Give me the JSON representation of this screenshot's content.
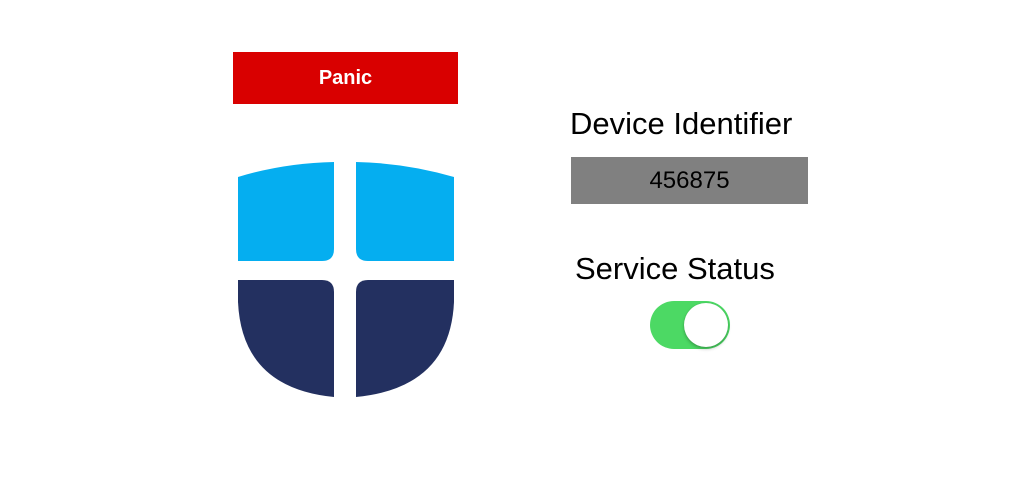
{
  "panic": {
    "label": "Panic",
    "color": "#d90000"
  },
  "logo": {
    "icon": "shield-icon",
    "colors": {
      "top": "#05aef0",
      "bottom": "#233060"
    }
  },
  "device": {
    "label": "Device Identifier",
    "value": "456875"
  },
  "service": {
    "label": "Service Status",
    "enabled": true,
    "toggle_color": "#4cd964"
  }
}
